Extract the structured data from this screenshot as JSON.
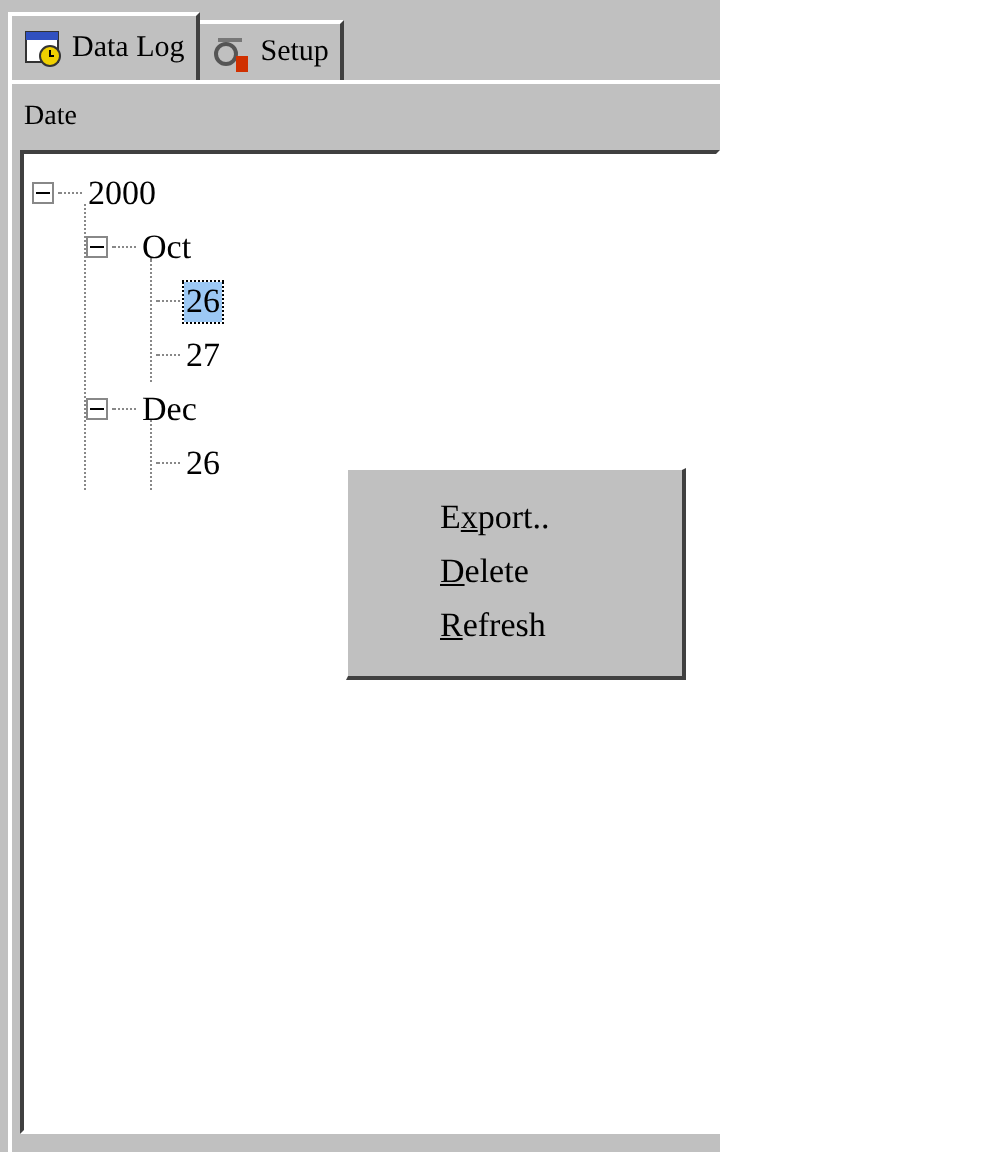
{
  "tabs": [
    {
      "label": "Data Log",
      "selected": true
    },
    {
      "label": "Setup",
      "selected": false
    }
  ],
  "panel": {
    "title": "Date"
  },
  "tree": [
    {
      "label": "2000",
      "expanded": true,
      "selected": false,
      "children": [
        {
          "label": "Oct",
          "expanded": true,
          "selected": false,
          "children": [
            {
              "label": "26",
              "selected": true
            },
            {
              "label": "27",
              "selected": false
            }
          ]
        },
        {
          "label": "Dec",
          "expanded": true,
          "selected": false,
          "children": [
            {
              "label": "26",
              "selected": false
            }
          ]
        }
      ]
    }
  ],
  "context_menu": [
    {
      "before": "E",
      "key": "x",
      "after": "port.."
    },
    {
      "key": "D",
      "after": "elete"
    },
    {
      "key": "R",
      "after": "efresh"
    }
  ]
}
